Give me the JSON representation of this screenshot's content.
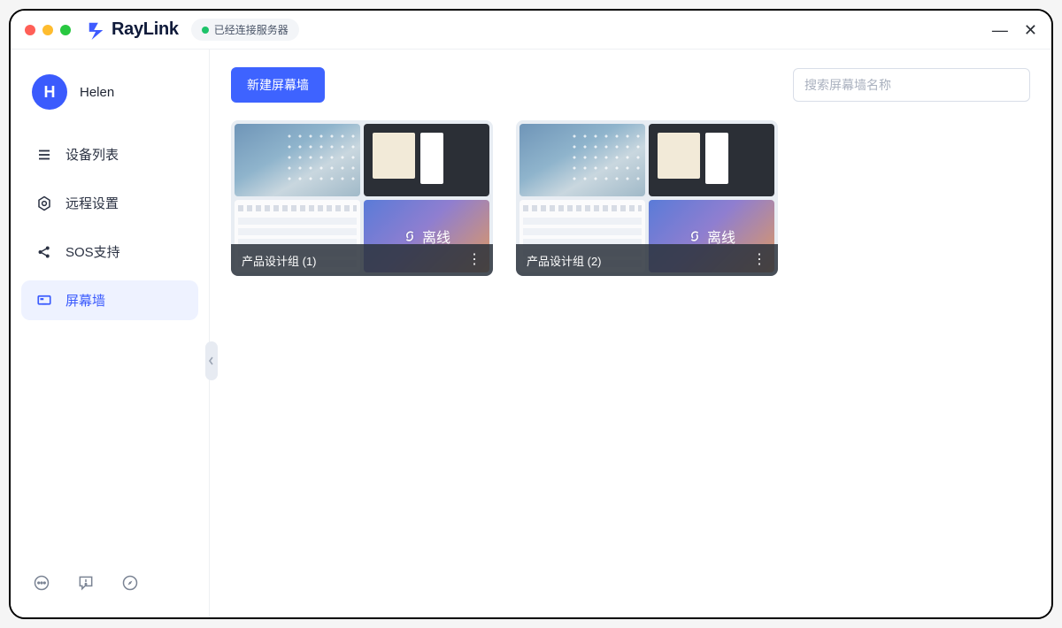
{
  "brand": {
    "name": "RayLink"
  },
  "connection": {
    "status_label": "已经连接服务器"
  },
  "user": {
    "initial": "H",
    "name": "Helen"
  },
  "sidebar": {
    "items": [
      {
        "label": "设备列表"
      },
      {
        "label": "远程设置"
      },
      {
        "label": "SOS支持"
      },
      {
        "label": "屏幕墙"
      }
    ]
  },
  "toolbar": {
    "create_label": "新建屏幕墙"
  },
  "search": {
    "placeholder": "搜索屏幕墙名称"
  },
  "offline_label": "离线",
  "cards": [
    {
      "title": "产品设计组 (1)"
    },
    {
      "title": "产品设计组 (2)"
    }
  ]
}
